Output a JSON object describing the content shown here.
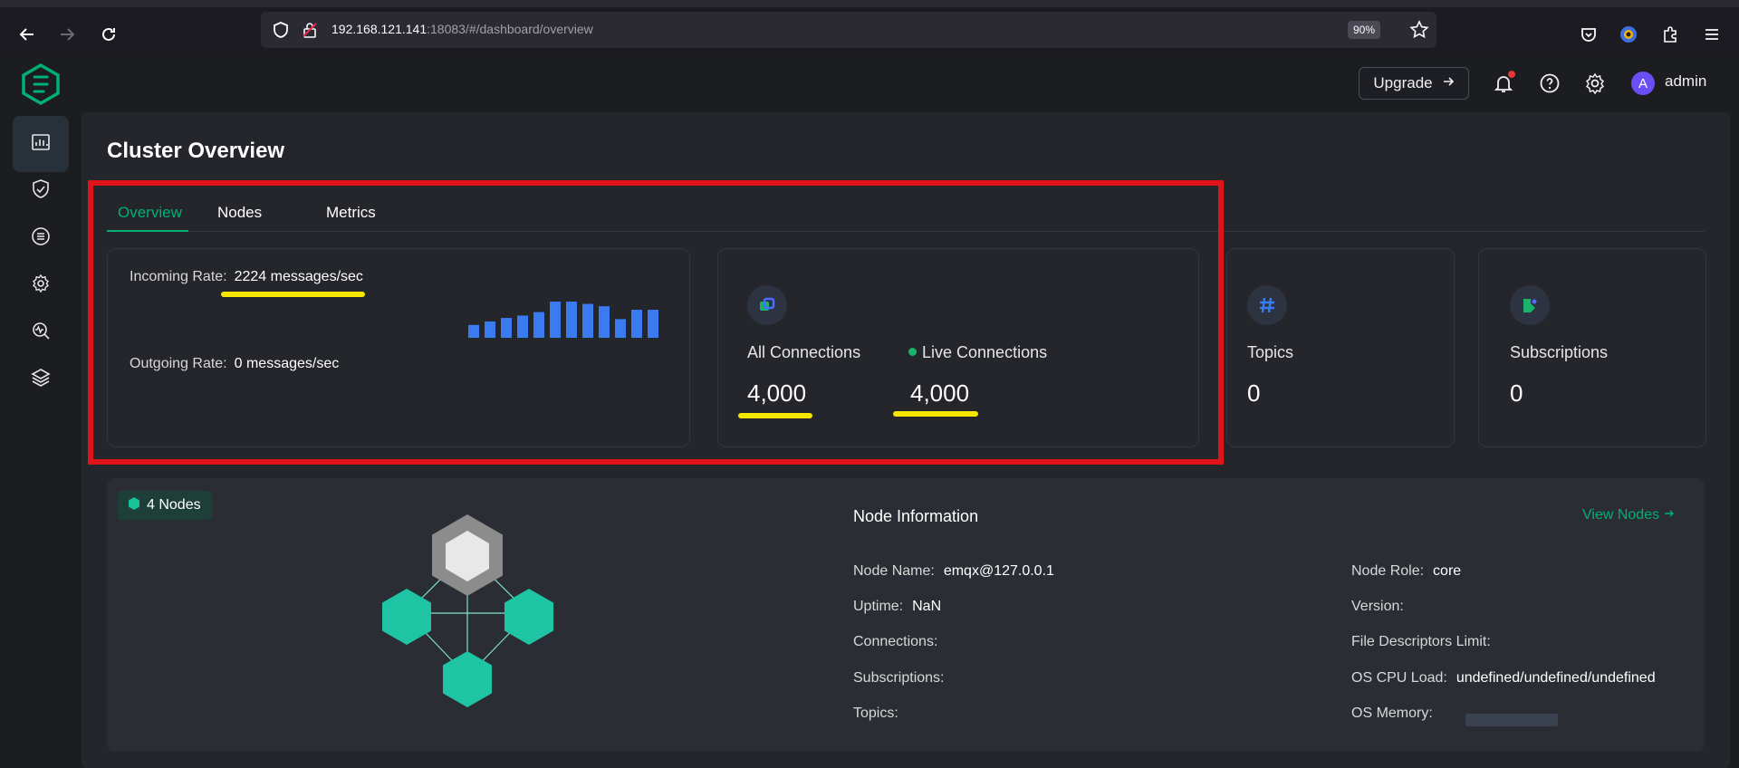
{
  "browser": {
    "url_host": "192.168.121.141",
    "url_rest": ":18083/#/dashboard/overview",
    "zoom": "90%"
  },
  "header": {
    "upgrade_label": "Upgrade",
    "user_initial": "A",
    "user_name": "admin"
  },
  "page": {
    "title": "Cluster Overview"
  },
  "tabs": [
    {
      "label": "Overview",
      "active": true
    },
    {
      "label": "Nodes",
      "active": false
    },
    {
      "label": "Metrics",
      "active": false
    }
  ],
  "rates": {
    "incoming_label": "Incoming Rate:",
    "incoming_value": "2224 messages/sec",
    "outgoing_label": "Outgoing Rate:",
    "outgoing_value": "0 messages/sec",
    "sparkline": [
      11,
      14,
      17,
      19,
      22,
      31,
      31,
      29,
      27,
      16,
      24,
      24
    ]
  },
  "stats": {
    "all_connections_label": "All Connections",
    "all_connections_value": "4,000",
    "live_connections_label": "Live Connections",
    "live_connections_value": "4,000",
    "topics_label": "Topics",
    "topics_value": "0",
    "subscriptions_label": "Subscriptions",
    "subscriptions_value": "0"
  },
  "nodes": {
    "badge": "4 Nodes",
    "info_title": "Node Information",
    "view_nodes": "View Nodes",
    "left": [
      {
        "label": "Node Name:",
        "value": "emqx@127.0.0.1"
      },
      {
        "label": "Uptime:",
        "value": "NaN"
      },
      {
        "label": "Connections:",
        "value": ""
      },
      {
        "label": "Subscriptions:",
        "value": ""
      },
      {
        "label": "Topics:",
        "value": ""
      }
    ],
    "right": [
      {
        "label": "Node Role:",
        "value": "core"
      },
      {
        "label": "Version:",
        "value": ""
      },
      {
        "label": "File Descriptors Limit:",
        "value": ""
      },
      {
        "label": "OS CPU Load:",
        "value": "undefined/undefined/undefined"
      },
      {
        "label": "OS Memory:",
        "value": ""
      }
    ]
  },
  "colors": {
    "accent": "#00b173",
    "bar": "#3b7bf0",
    "highlight_frame": "#e0131b",
    "underline": "#f6e600"
  }
}
